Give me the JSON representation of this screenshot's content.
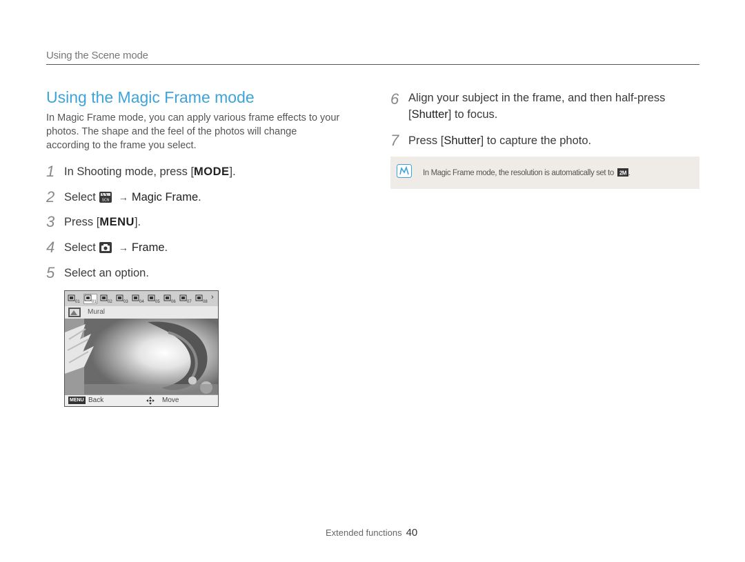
{
  "header": {
    "section": "Using the Scene mode"
  },
  "title": "Using the Magic Frame mode",
  "intro": "In Magic Frame mode, you can apply various frame effects to your photos. The shape and the feel of the photos will change according to the frame you select.",
  "steps": [
    {
      "num": "1",
      "pre": "In Shooting mode, press [",
      "key": "MODE",
      "post": "]."
    },
    {
      "num": "2",
      "pre": "Select",
      "icon": "scene-icon",
      "target": "Magic Frame",
      "post": "."
    },
    {
      "num": "3",
      "pre": "Press [",
      "key": "MENU",
      "post": "]."
    },
    {
      "num": "4",
      "pre": "Select",
      "icon": "camera-icon",
      "target": "Frame",
      "post": "."
    },
    {
      "num": "5",
      "text": "Select an option."
    },
    {
      "num": "6",
      "line1": "Align your subject in the frame, and then half-press",
      "line2_pre": "[",
      "key": "Shutter",
      "line2_post": "] to focus."
    },
    {
      "num": "7",
      "pre": "Press [",
      "key": "Shutter",
      "post": "] to capture the photo."
    }
  ],
  "screen": {
    "frame_labels": [
      "01",
      "02",
      "03",
      "04",
      "05",
      "06",
      "07",
      "08"
    ],
    "option_label": "Mural",
    "back_key": "MENU",
    "back_label": "Back",
    "move_label": "Move"
  },
  "note": {
    "text": "In Magic Frame mode, the resolution is automatically set to",
    "icon": "resolution-2m-icon"
  },
  "footer": {
    "section": "Extended functions",
    "page": "40"
  },
  "colors": {
    "title": "#3da3d9",
    "note_bg": "#efece7",
    "note_icon": "#3da3d9"
  }
}
